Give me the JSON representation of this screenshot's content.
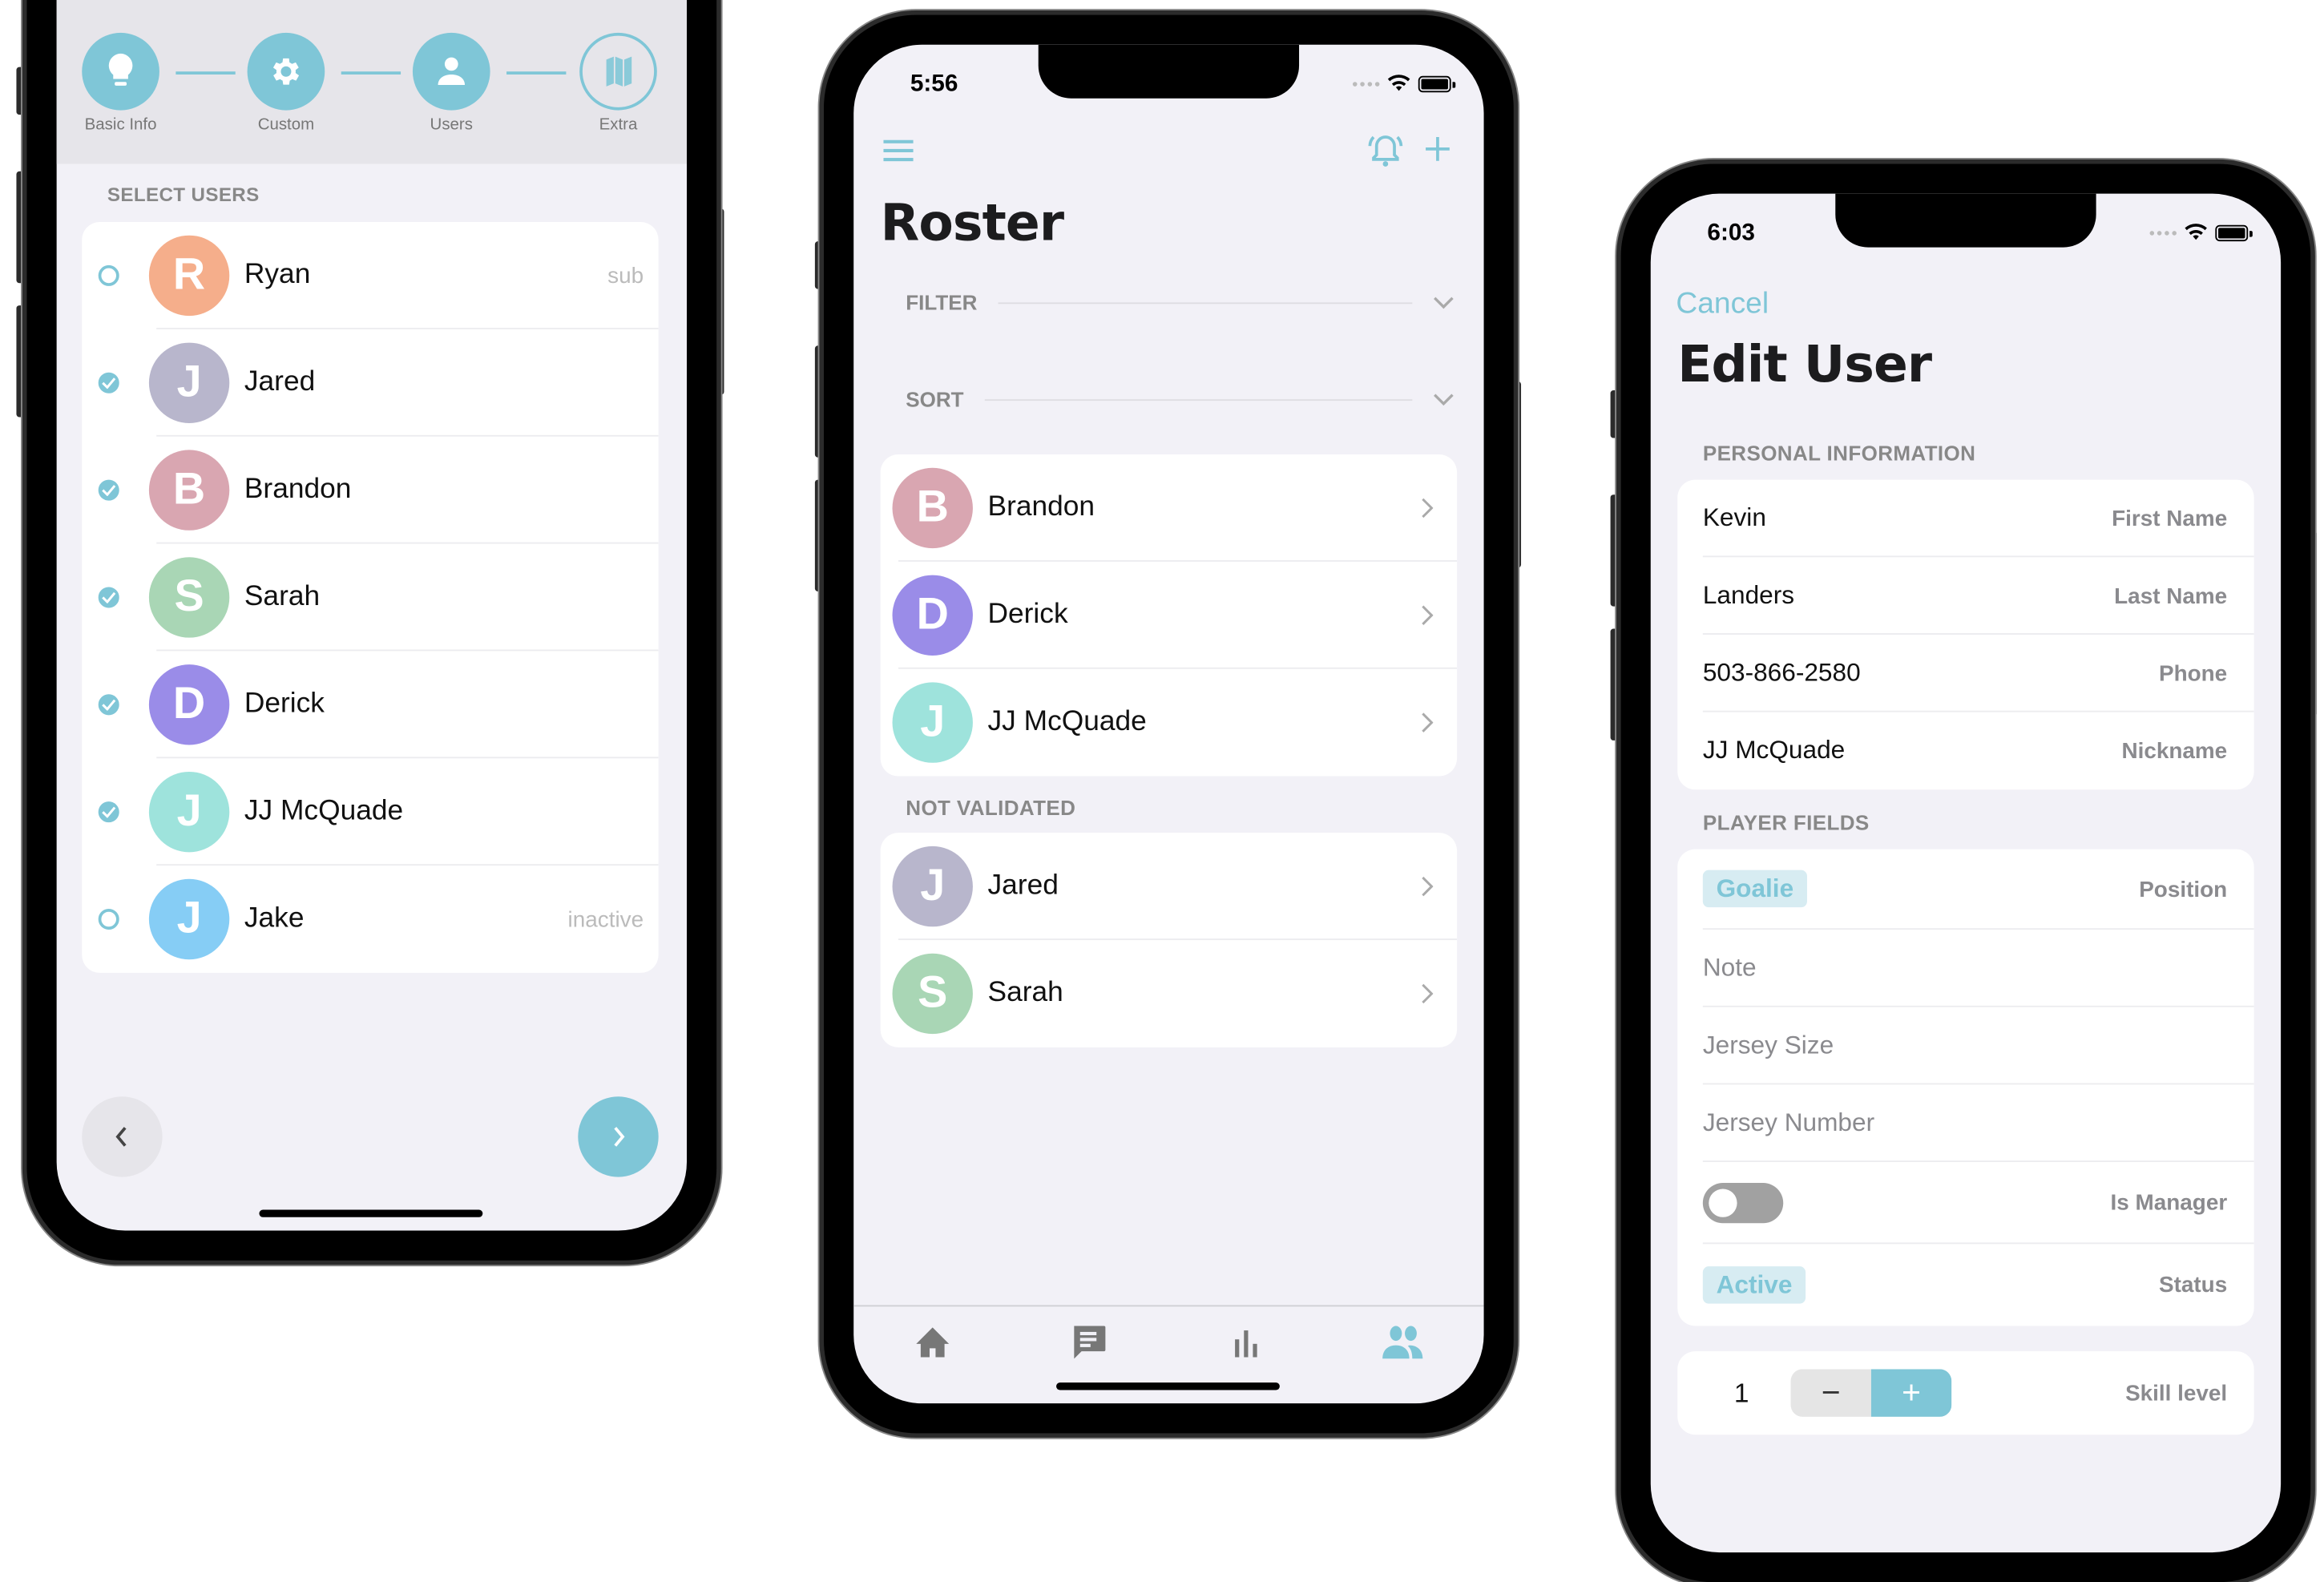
{
  "colors": {
    "accent": "#7fc6d7",
    "background": "#f2f1f7",
    "card": "#ffffff",
    "muted": "#8a8a8e"
  },
  "phone_wizard": {
    "steps": [
      {
        "label": "Basic Info",
        "icon": "lightbulb-icon",
        "state": "done"
      },
      {
        "label": "Custom",
        "icon": "gear-icon",
        "state": "done"
      },
      {
        "label": "Users",
        "icon": "person-icon",
        "state": "current"
      },
      {
        "label": "Extra",
        "icon": "map-icon",
        "state": "pending"
      }
    ],
    "section_header": "SELECT USERS",
    "users": [
      {
        "initial": "R",
        "name": "Ryan",
        "tag": "sub",
        "selected": false,
        "color": "#f5ae8b"
      },
      {
        "initial": "J",
        "name": "Jared",
        "tag": "",
        "selected": true,
        "color": "#b8b6cc"
      },
      {
        "initial": "B",
        "name": "Brandon",
        "tag": "",
        "selected": true,
        "color": "#d9a6b1"
      },
      {
        "initial": "S",
        "name": "Sarah",
        "tag": "",
        "selected": true,
        "color": "#a9d6b5"
      },
      {
        "initial": "D",
        "name": "Derick",
        "tag": "",
        "selected": true,
        "color": "#9a8ce8"
      },
      {
        "initial": "J",
        "name": "JJ McQuade",
        "tag": "",
        "selected": true,
        "color": "#9ee3dc"
      },
      {
        "initial": "J",
        "name": "Jake",
        "tag": "inactive",
        "selected": false,
        "color": "#86cdf5"
      }
    ],
    "back_icon": "chevron-left-icon",
    "next_icon": "chevron-right-icon"
  },
  "phone_roster": {
    "status_time": "5:56",
    "title": "Roster",
    "filter_label": "FILTER",
    "sort_label": "SORT",
    "validated": [
      {
        "initial": "B",
        "name": "Brandon",
        "color": "#d9a6b1"
      },
      {
        "initial": "D",
        "name": "Derick",
        "color": "#9a8ce8"
      },
      {
        "initial": "J",
        "name": "JJ McQuade",
        "color": "#9ee3dc"
      }
    ],
    "not_validated_header": "NOT VALIDATED",
    "not_validated": [
      {
        "initial": "J",
        "name": "Jared",
        "color": "#b8b6cc"
      },
      {
        "initial": "S",
        "name": "Sarah",
        "color": "#a9d6b5"
      }
    ],
    "tabs": [
      {
        "name": "home",
        "icon": "home-icon",
        "active": false
      },
      {
        "name": "messages",
        "icon": "message-icon",
        "active": false
      },
      {
        "name": "stats",
        "icon": "bar-chart-icon",
        "active": false
      },
      {
        "name": "roster",
        "icon": "people-icon",
        "active": true
      }
    ]
  },
  "phone_edit": {
    "status_time": "6:03",
    "cancel_label": "Cancel",
    "title": "Edit User",
    "personal_header": "PERSONAL INFORMATION",
    "personal_fields": [
      {
        "value": "Kevin",
        "label": "First Name"
      },
      {
        "value": "Landers",
        "label": "Last Name"
      },
      {
        "value": "503-866-2580",
        "label": "Phone"
      },
      {
        "value": "JJ McQuade",
        "label": "Nickname"
      }
    ],
    "player_header": "PLAYER FIELDS",
    "position": {
      "value": "Goalie",
      "label": "Position"
    },
    "note_placeholder": "Note",
    "jersey_size_placeholder": "Jersey Size",
    "jersey_number_placeholder": "Jersey Number",
    "is_manager": {
      "label": "Is Manager",
      "on": false
    },
    "status": {
      "value": "Active",
      "label": "Status"
    },
    "skill": {
      "value": "1",
      "label": "Skill level",
      "minus": "−",
      "plus": "+"
    }
  }
}
